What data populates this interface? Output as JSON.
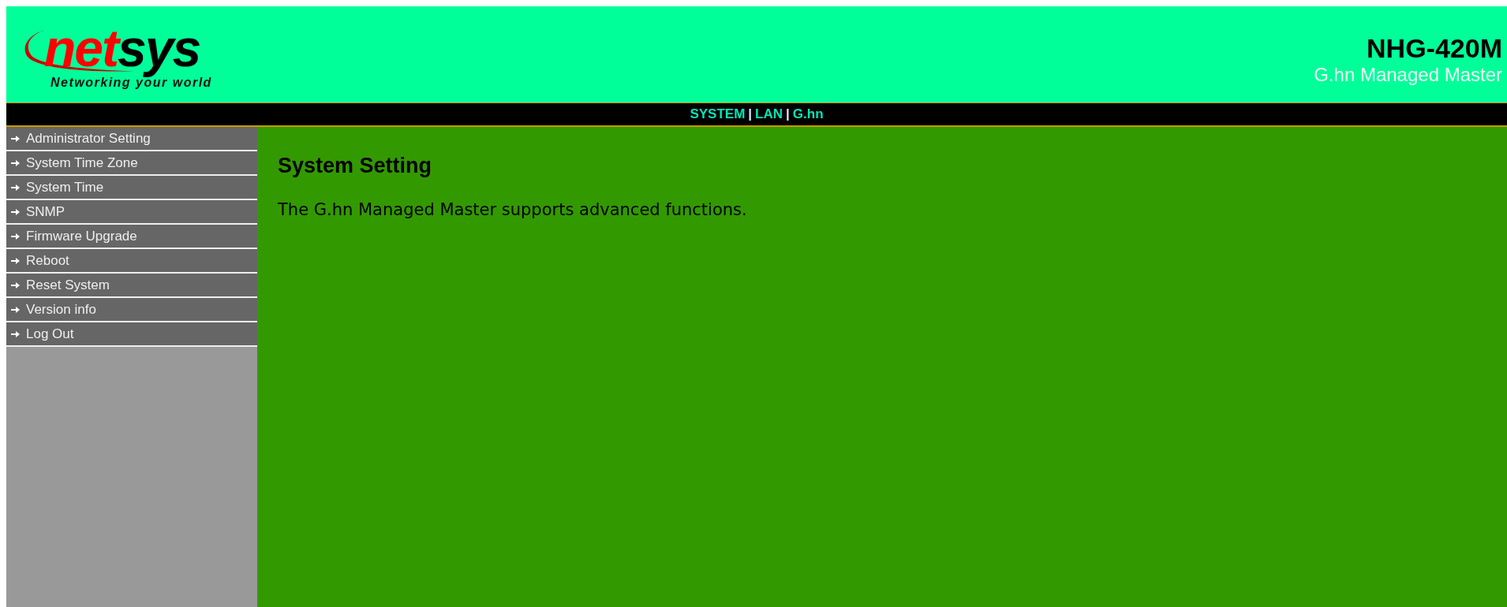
{
  "logo": {
    "part_1": "net",
    "part_2": "sys",
    "tagline": "Networking your world"
  },
  "product": {
    "model": "NHG-420M",
    "name": "G.hn Managed Master"
  },
  "nav": {
    "links": [
      "SYSTEM",
      "LAN",
      "G.hn"
    ],
    "separator": "|"
  },
  "sidebar": {
    "items": [
      {
        "label": "Administrator Setting"
      },
      {
        "label": "System Time Zone"
      },
      {
        "label": "System Time"
      },
      {
        "label": "SNMP"
      },
      {
        "label": "Firmware Upgrade"
      },
      {
        "label": "Reboot"
      },
      {
        "label": "Reset System"
      },
      {
        "label": "Version info"
      },
      {
        "label": "Log Out"
      }
    ]
  },
  "content": {
    "title": "System Setting",
    "text": "The G.hn Managed Master supports advanced functions."
  }
}
